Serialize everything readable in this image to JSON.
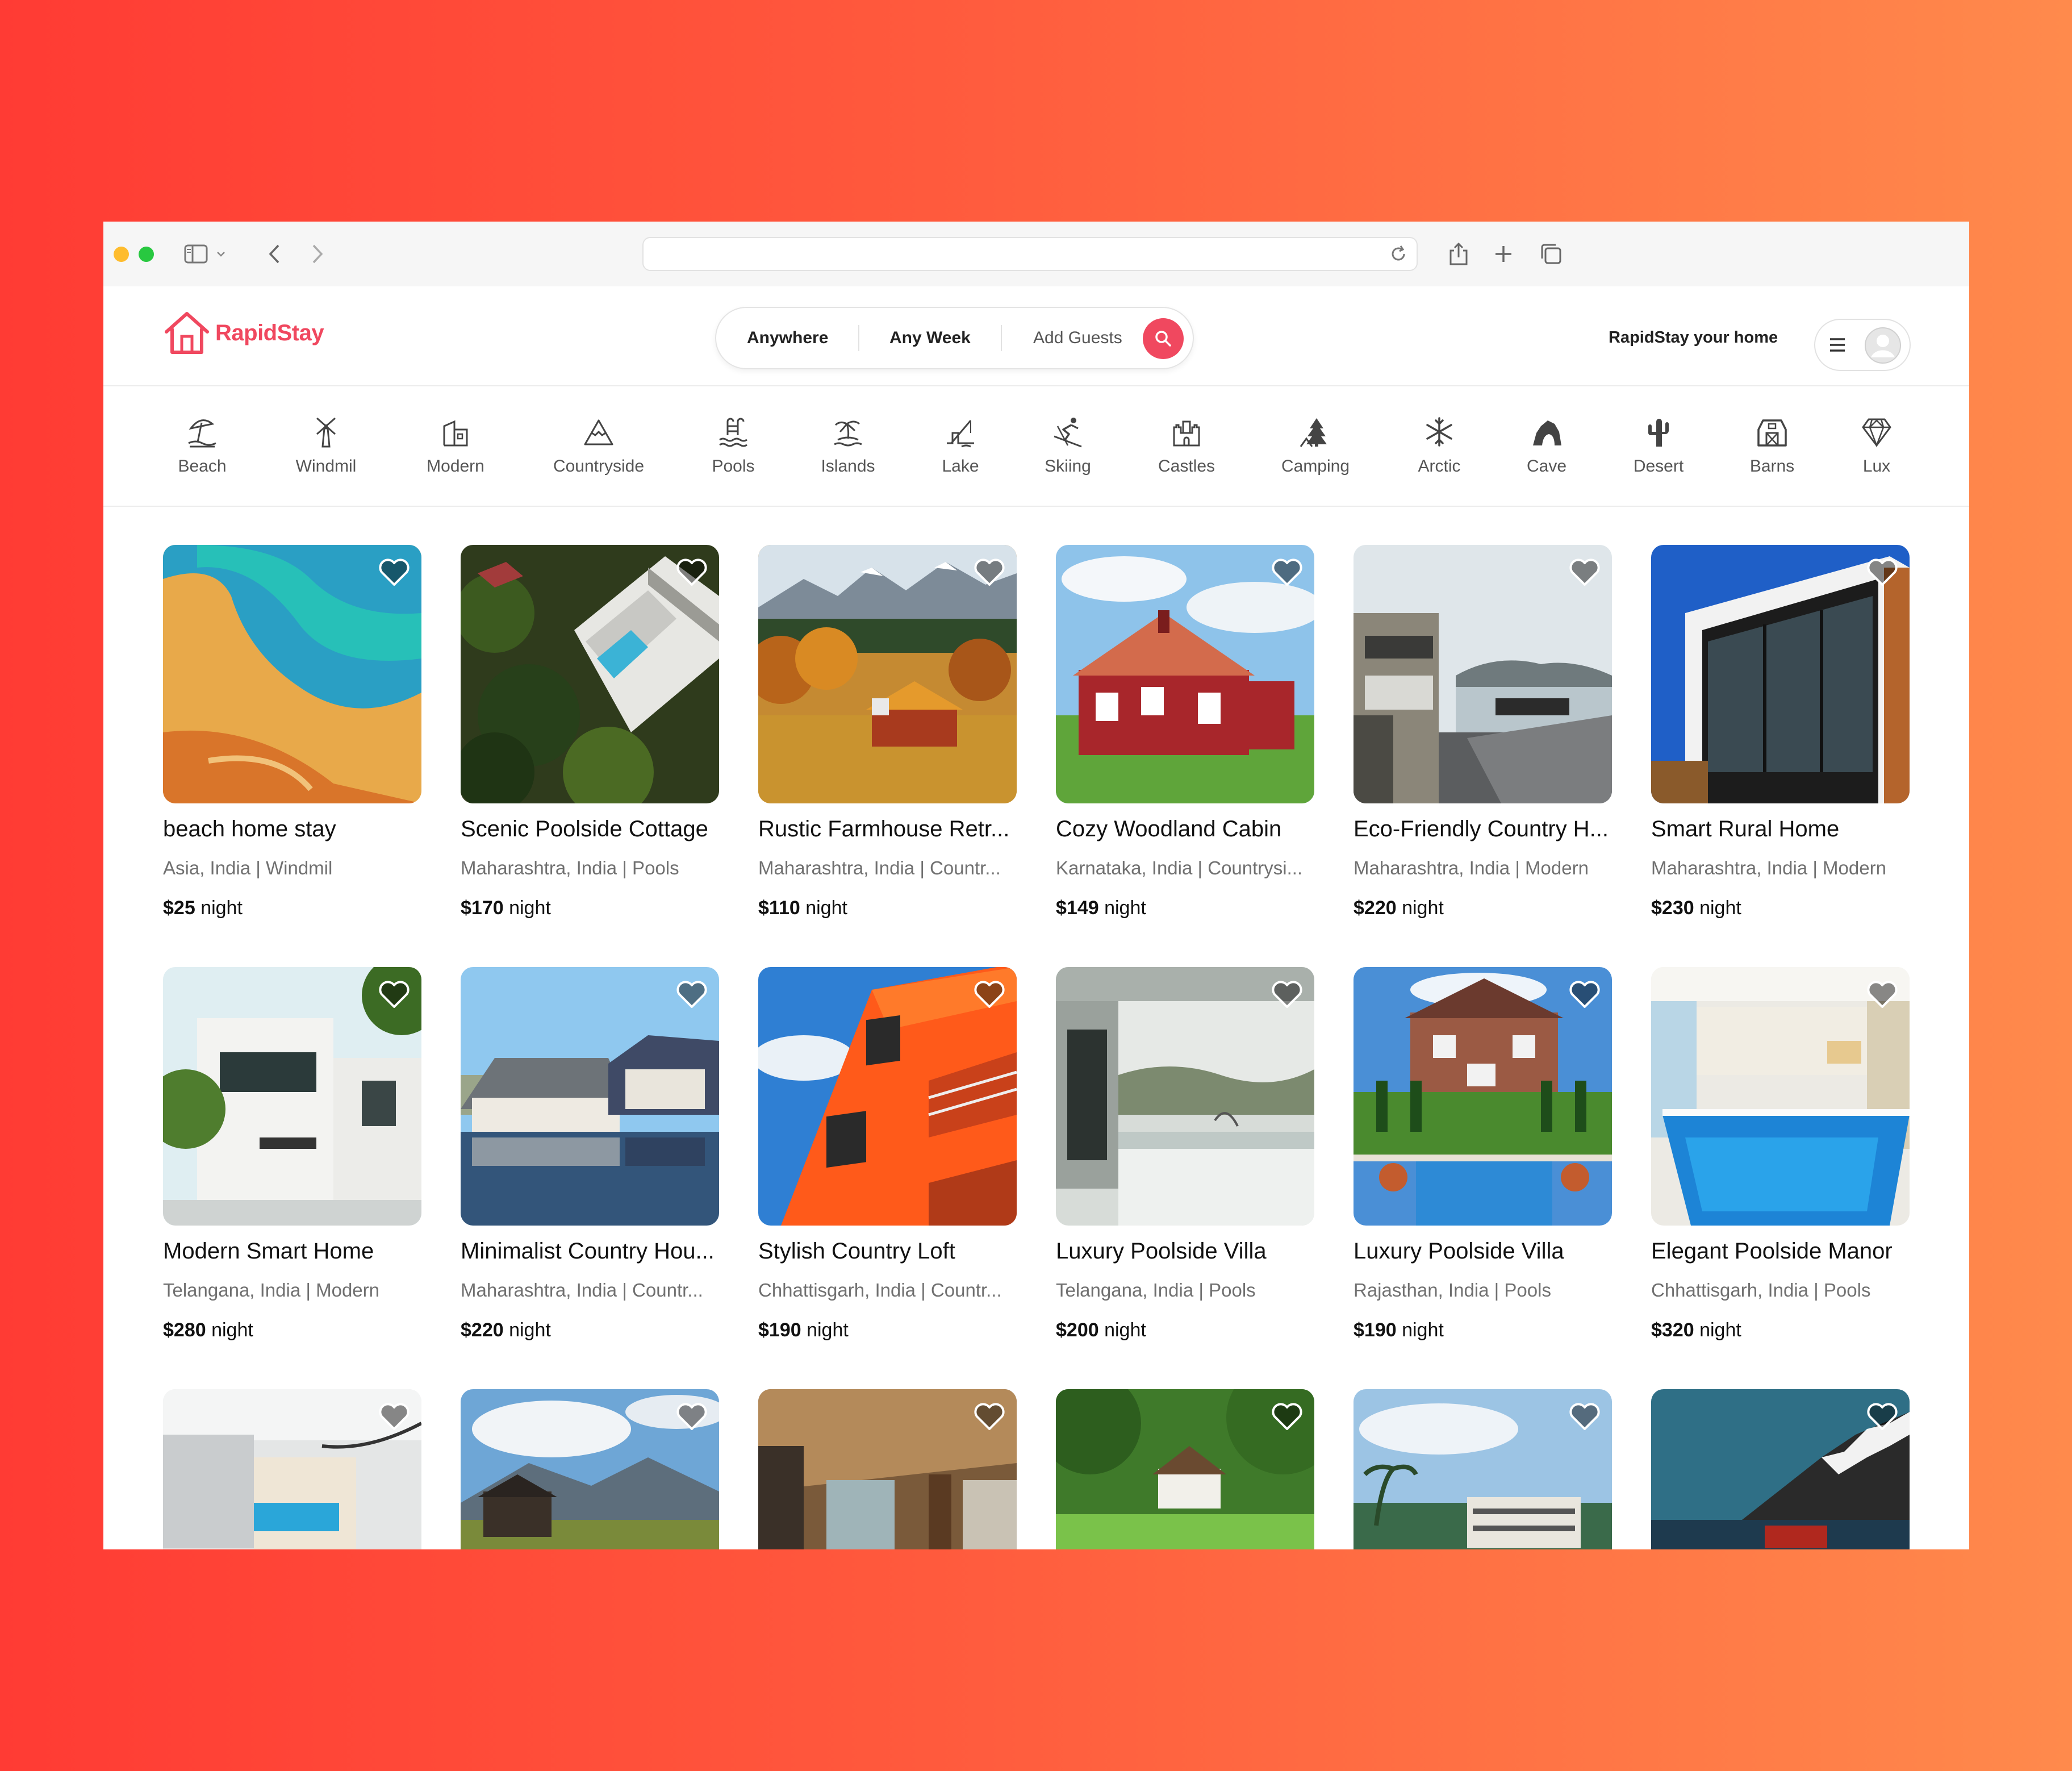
{
  "browser": {
    "address": "",
    "icons": [
      "sidebar-icon",
      "chevron-down-icon",
      "back-icon",
      "forward-icon",
      "reload-icon",
      "share-icon",
      "plus-icon",
      "tabs-icon"
    ]
  },
  "header": {
    "logo_text": "RapidStay",
    "search": {
      "where": "Anywhere",
      "when": "Any Week",
      "guests": "Add Guests"
    },
    "host_link": "RapidStay your home"
  },
  "categories": [
    {
      "label": "Beach",
      "icon": "beach-umbrella-icon"
    },
    {
      "label": "Windmil",
      "icon": "windmill-icon"
    },
    {
      "label": "Modern",
      "icon": "modern-building-icon"
    },
    {
      "label": "Countryside",
      "icon": "mountain-icon"
    },
    {
      "label": "Pools",
      "icon": "pool-ladder-icon"
    },
    {
      "label": "Islands",
      "icon": "island-palm-icon"
    },
    {
      "label": "Lake",
      "icon": "lake-fishing-icon"
    },
    {
      "label": "Skiing",
      "icon": "skier-icon"
    },
    {
      "label": "Castles",
      "icon": "castle-icon"
    },
    {
      "label": "Camping",
      "icon": "camping-tent-icon"
    },
    {
      "label": "Arctic",
      "icon": "snowflake-icon"
    },
    {
      "label": "Cave",
      "icon": "cave-icon"
    },
    {
      "label": "Desert",
      "icon": "cactus-icon"
    },
    {
      "label": "Barns",
      "icon": "barn-icon"
    },
    {
      "label": "Lux",
      "icon": "diamond-icon"
    }
  ],
  "listings": [
    {
      "title": "beach home stay",
      "location": "Asia, India | Windmil",
      "price": "$25",
      "unit": "night"
    },
    {
      "title": "Scenic Poolside Cottage",
      "location": "Maharashtra, India | Pools",
      "price": "$170",
      "unit": "night"
    },
    {
      "title": "Rustic Farmhouse Retr...",
      "location": "Maharashtra, India | Countr...",
      "price": "$110",
      "unit": "night"
    },
    {
      "title": "Cozy Woodland Cabin",
      "location": "Karnataka, India | Countrysi...",
      "price": "$149",
      "unit": "night"
    },
    {
      "title": "Eco-Friendly Country H...",
      "location": "Maharashtra, India | Modern",
      "price": "$220",
      "unit": "night"
    },
    {
      "title": "Smart Rural Home",
      "location": "Maharashtra, India | Modern",
      "price": "$230",
      "unit": "night"
    },
    {
      "title": "Modern Smart Home",
      "location": "Telangana, India | Modern",
      "price": "$280",
      "unit": "night"
    },
    {
      "title": "Minimalist Country Hou...",
      "location": "Maharashtra, India | Countr...",
      "price": "$220",
      "unit": "night"
    },
    {
      "title": "Stylish Country Loft",
      "location": "Chhattisgarh, India | Countr...",
      "price": "$190",
      "unit": "night"
    },
    {
      "title": "Luxury Poolside Villa",
      "location": "Telangana, India | Pools",
      "price": "$200",
      "unit": "night"
    },
    {
      "title": "Luxury Poolside Villa",
      "location": "Rajasthan, India | Pools",
      "price": "$190",
      "unit": "night"
    },
    {
      "title": "Elegant Poolside Manor",
      "location": "Chhattisgarh, India | Pools",
      "price": "$320",
      "unit": "night"
    },
    {
      "title": "",
      "location": "",
      "price": "",
      "unit": ""
    },
    {
      "title": "",
      "location": "",
      "price": "",
      "unit": ""
    },
    {
      "title": "",
      "location": "",
      "price": "",
      "unit": ""
    },
    {
      "title": "",
      "location": "",
      "price": "",
      "unit": ""
    },
    {
      "title": "",
      "location": "",
      "price": "",
      "unit": ""
    },
    {
      "title": "",
      "location": "",
      "price": "",
      "unit": ""
    }
  ],
  "colors": {
    "brand": "#f0485f",
    "text": "#111111",
    "muted": "#707070"
  }
}
